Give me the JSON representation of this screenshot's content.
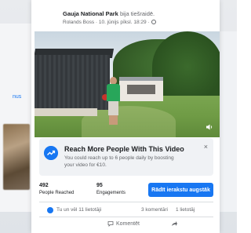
{
  "header": {
    "page_name": "Gauja National Park",
    "shared_text": "bija tiešraidē.",
    "author": "Rolands Boss",
    "meta": "· 10. jūnijs pīksl. 18:29 ·"
  },
  "background": {
    "left_link": "nus"
  },
  "boost_panel": {
    "title": "Reach More People With This Video",
    "description": "You could reach up to 6 people daily by boosting your video for €10.",
    "close_icon": "×"
  },
  "stats": {
    "reached_value": "492",
    "reached_label": "People Reached",
    "engagements_value": "95",
    "engagements_label": "Engagements"
  },
  "boost_button": {
    "label": "Rādīt ierakstu augstāk"
  },
  "reactions": {
    "likes_text": "Tu un vēl 11 lietotāji",
    "comments_text": "3 komentāri",
    "shares_text": "1 lietotāj"
  },
  "actions": {
    "comment_label": "Komentēt"
  },
  "colors": {
    "accent": "#1877f2",
    "panel_bg": "#f0f2f5",
    "text": "#1c1e21",
    "muted": "#65676b"
  }
}
